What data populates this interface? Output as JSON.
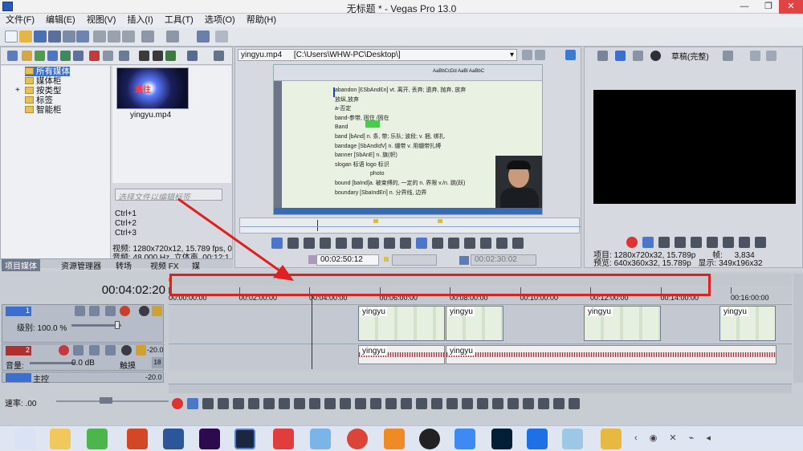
{
  "window": {
    "title": "无标题 * - Vegas Pro 13.0"
  },
  "menu": [
    "文件(F)",
    "编辑(E)",
    "视图(V)",
    "插入(I)",
    "工具(T)",
    "选项(O)",
    "帮助(H)"
  ],
  "explorer": {
    "tree": [
      "所有媒体",
      "媒体柜",
      "按类型",
      "标签",
      "智能柜"
    ],
    "media_name": "yingyu.mp4",
    "tag_placeholder": "选择文件以编辑标签",
    "shortcuts": [
      "Ctrl+1",
      "Ctrl+2",
      "Ctrl+3"
    ],
    "info_video": "视频: 1280x720x12, 15.789 fps, 0",
    "info_audio": "音频: 48,000 Hz, 立体声, 00:12:1",
    "tabs": [
      "项目媒体",
      "资源管理器",
      "转场",
      "视频 FX",
      "媒"
    ]
  },
  "trimmer": {
    "file": "yingyu.mp4",
    "path": "[C:\\Users\\WHW-PC\\Desktop\\]",
    "time_in": "00:02:50:12",
    "time_out": "00:02:30:02"
  },
  "doc_lines": [
    "abandon [ƐSbAndƐn]  vt. 离开, 丢弃; 遗弃, 抛弃, 放弃",
    "放纵,放弃",
    "a-否定",
    "band-参带, 困住 /困在",
    "Band",
    "band [bAnd]   n. 条, 带; 乐队; 波段; v. 捆, 绑扎",
    "bandage [SbAndIdV]   n. 绷带  v. 用绷带扎缚",
    "banner  [SbAnE]   n. 旗(帜)",
    "slogan 标语  logo  标识",
    "photo",
    "bound  [baInd]a. 被束缚的, 一定的  n. 界限 v./n. 跳(跃)",
    "boundary [SbaIndEri]  n. 分界线, 边界"
  ],
  "preview": {
    "quality": "草稿(完整)",
    "project_label": "项目:",
    "project": "1280x720x32, 15.789p",
    "frame_label": "帧:",
    "frame": "3,834",
    "preview_label": "预览:",
    "preview": "640x360x32, 15.789p",
    "display_label": "显示:",
    "display": "349x196x32"
  },
  "timeline": {
    "timecode": "00:04:02:20",
    "ruler": [
      "00:00:00:00",
      "00:02:00:00",
      "00:04:00:00",
      "00:06:00:00",
      "00:08:00:00",
      "00:10:00:00",
      "00:12:00:00",
      "00:14:00:00",
      "00:16:00:00"
    ],
    "video_track": {
      "num": "1",
      "level": "级别: 100.0 %"
    },
    "audio_track": {
      "num": "2",
      "vol_label": "音量:",
      "vol": "0.0 dB",
      "pan_label": "触摸",
      "db": "-20.0"
    },
    "master": {
      "label": "主控",
      "db1": "-20.0",
      "db2": "-20.0"
    },
    "rate": "速率: .00",
    "clip_name": "yingyu",
    "meter_db": [
      "-20.0",
      "-20.0"
    ]
  },
  "colors": {
    "highlight_box": "#e02020",
    "arrow": "#e02020",
    "accent": "#3a6fd0"
  },
  "annotation": {
    "value_mark": "18"
  }
}
